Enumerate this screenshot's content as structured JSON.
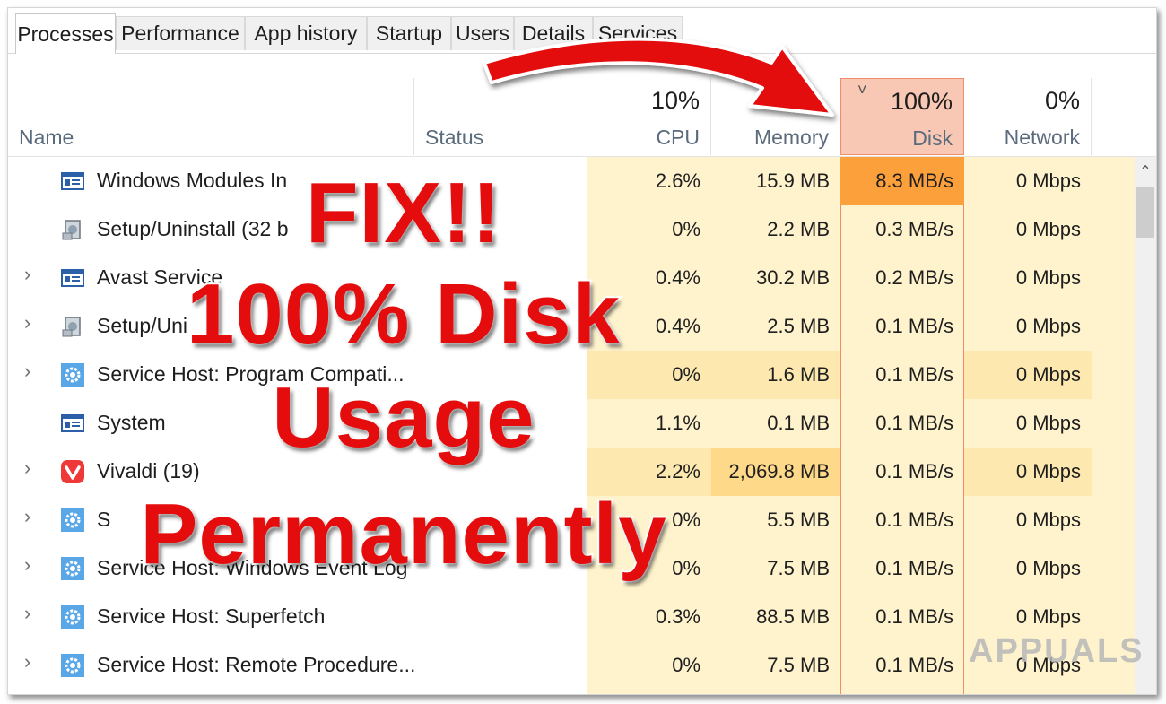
{
  "tabs": [
    "Processes",
    "Performance",
    "App history",
    "Startup",
    "Users",
    "Details",
    "Services"
  ],
  "header": {
    "name": "Name",
    "status": "Status",
    "cpu": {
      "percent": "10%",
      "label": "CPU"
    },
    "memory": {
      "percent": "",
      "label": "Memory"
    },
    "disk": {
      "percent": "100%",
      "label": "Disk"
    },
    "network": {
      "percent": "0%",
      "label": "Network"
    },
    "sort_indicator": "˅"
  },
  "processes": [
    {
      "name": "Windows Modules In",
      "icon": "window-app-icon",
      "expandable": false,
      "cpu": "2.6%",
      "memory": "15.9 MB",
      "disk": "8.3 MB/s",
      "network": "0 Mbps"
    },
    {
      "name": "Setup/Uninstall (32 b",
      "icon": "installer-icon",
      "expandable": false,
      "cpu": "0%",
      "memory": "2.2 MB",
      "disk": "0.3 MB/s",
      "network": "0 Mbps"
    },
    {
      "name": "Avast Service",
      "icon": "window-app-icon",
      "expandable": true,
      "cpu": "0.4%",
      "memory": "30.2 MB",
      "disk": "0.2 MB/s",
      "network": "0 Mbps"
    },
    {
      "name": "Setup/Uni",
      "icon": "installer-icon",
      "expandable": true,
      "cpu": "0.4%",
      "memory": "2.5 MB",
      "disk": "0.1 MB/s",
      "network": "0 Mbps"
    },
    {
      "name": "Service Host: Program Compati...",
      "icon": "gear-service-icon",
      "expandable": true,
      "cpu": "0%",
      "memory": "1.6 MB",
      "disk": "0.1 MB/s",
      "network": "0 Mbps"
    },
    {
      "name": "System",
      "icon": "window-app-icon",
      "expandable": false,
      "cpu": "1.1%",
      "memory": "0.1 MB",
      "disk": "0.1 MB/s",
      "network": "0 Mbps"
    },
    {
      "name": "Vivaldi (19)",
      "icon": "vivaldi-icon",
      "expandable": true,
      "cpu": "2.2%",
      "memory": "2,069.8 MB",
      "disk": "0.1 MB/s",
      "network": "0 Mbps"
    },
    {
      "name": "S",
      "icon": "gear-service-icon",
      "expandable": true,
      "cpu": "0%",
      "memory": "5.5 MB",
      "disk": "0.1 MB/s",
      "network": "0 Mbps"
    },
    {
      "name": "Service Host: Windows Event Log",
      "icon": "gear-service-icon",
      "expandable": true,
      "cpu": "0%",
      "memory": "7.5 MB",
      "disk": "0.1 MB/s",
      "network": "0 Mbps"
    },
    {
      "name": "Service Host: Superfetch",
      "icon": "gear-service-icon",
      "expandable": true,
      "cpu": "0.3%",
      "memory": "88.5 MB",
      "disk": "0.1 MB/s",
      "network": "0 Mbps"
    },
    {
      "name": "Service Host: Remote Procedure...",
      "icon": "gear-service-icon",
      "expandable": true,
      "cpu": "0%",
      "memory": "7.5 MB",
      "disk": "0.1 MB/s",
      "network": "0 Mbps"
    }
  ],
  "overlay": {
    "line1": "FIX!!",
    "line2": "100% Disk",
    "line3": "Usage",
    "line4": "Permanently",
    "watermark": "APPUALS"
  },
  "colors": {
    "headline_red": "#e40c0c",
    "disk_hot": "#fca03c",
    "usage_bg": "#fff3cd",
    "disk_header": "#f9c8b4"
  }
}
